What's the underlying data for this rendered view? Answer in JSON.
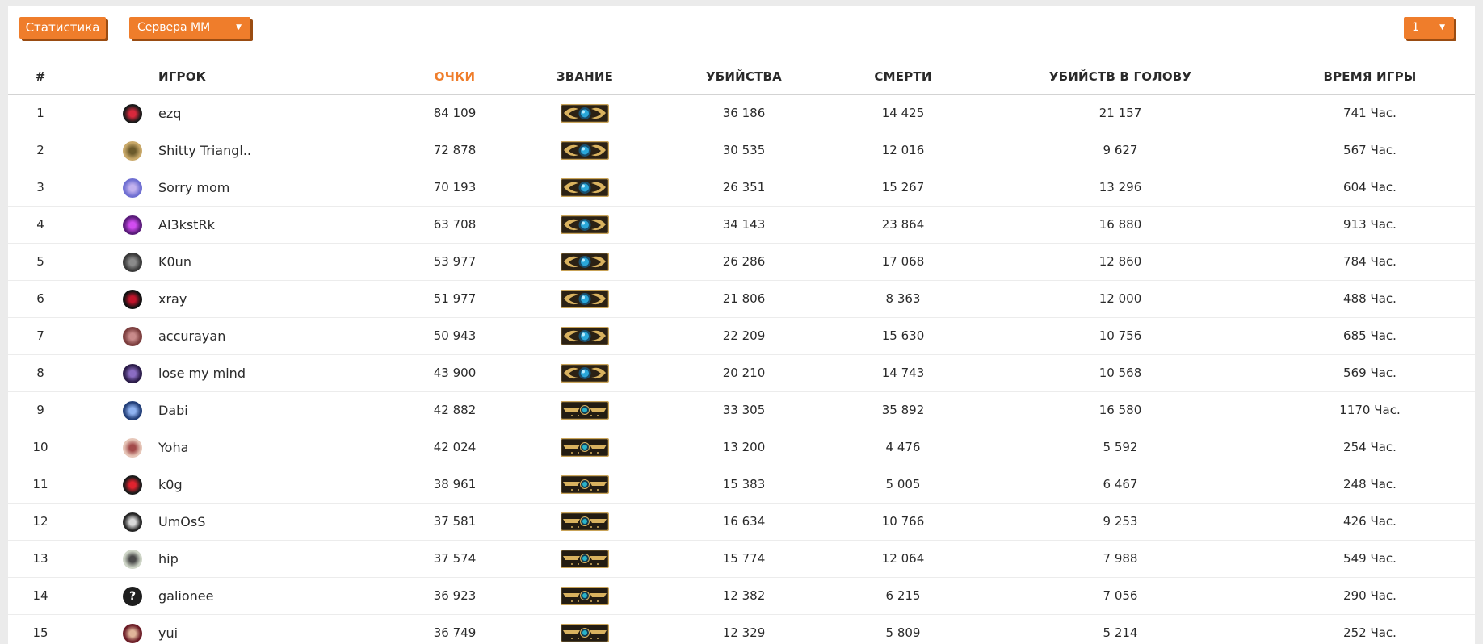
{
  "toolbar": {
    "stats_label": "Статистика",
    "servers_label": "Сервера ММ",
    "page_value": "1"
  },
  "columns": {
    "index": "#",
    "player": "ИГРОК",
    "points": "ОЧКИ",
    "rank": "ЗВАНИЕ",
    "kills": "УБИЙСТВА",
    "deaths": "СМЕРТИ",
    "headshots": "УБИЙСТВ В ГОЛОВУ",
    "playtime": "ВРЕМЯ ИГРЫ"
  },
  "colors": {
    "accent": "#ef7d2b",
    "accent_shadow": "#9a4c12",
    "text": "#2a2a2a"
  },
  "players": [
    {
      "n": "1",
      "name": "ezq",
      "points": "84 109",
      "rank": "global-elite",
      "kills": "36 186",
      "deaths": "14 425",
      "hs": "21 157",
      "time": "741 Час.",
      "avatar": {
        "color": "#1a1a1a",
        "accent": "#d8283c",
        "glyph": ""
      }
    },
    {
      "n": "2",
      "name": "Shitty Triangl..",
      "points": "72 878",
      "rank": "global-elite",
      "kills": "30 535",
      "deaths": "12 016",
      "hs": "9 627",
      "time": "567 Час.",
      "avatar": {
        "color": "#c9a96a",
        "accent": "#6b5a2c",
        "glyph": ""
      }
    },
    {
      "n": "3",
      "name": "Sorry mom",
      "points": "70 193",
      "rank": "global-elite",
      "kills": "26 351",
      "deaths": "15 267",
      "hs": "13 296",
      "time": "604 Час.",
      "avatar": {
        "color": "#6f6fd2",
        "accent": "#c2b1ee",
        "glyph": ""
      }
    },
    {
      "n": "4",
      "name": "Al3kstRk",
      "points": "63 708",
      "rank": "global-elite",
      "kills": "34 143",
      "deaths": "23 864",
      "hs": "16 880",
      "time": "913 Час.",
      "avatar": {
        "color": "#5a1c7a",
        "accent": "#d14cf0",
        "glyph": ""
      }
    },
    {
      "n": "5",
      "name": "K0un",
      "points": "53 977",
      "rank": "global-elite",
      "kills": "26 286",
      "deaths": "17 068",
      "hs": "12 860",
      "time": "784 Час.",
      "avatar": {
        "color": "#3a3a3a",
        "accent": "#8a8a8a",
        "glyph": ""
      }
    },
    {
      "n": "6",
      "name": "xray",
      "points": "51 977",
      "rank": "global-elite",
      "kills": "21 806",
      "deaths": "8 363",
      "hs": "12 000",
      "time": "488 Час.",
      "avatar": {
        "color": "#111111",
        "accent": "#c0142b",
        "glyph": ""
      }
    },
    {
      "n": "7",
      "name": "accurayan",
      "points": "50 943",
      "rank": "global-elite",
      "kills": "22 209",
      "deaths": "15 630",
      "hs": "10 756",
      "time": "685 Час.",
      "avatar": {
        "color": "#7c3e3e",
        "accent": "#c88a8a",
        "glyph": ""
      }
    },
    {
      "n": "8",
      "name": "lose my mind",
      "points": "43 900",
      "rank": "global-elite",
      "kills": "20 210",
      "deaths": "14 743",
      "hs": "10 568",
      "time": "569 Час.",
      "avatar": {
        "color": "#2c1d4a",
        "accent": "#8a6cc2",
        "glyph": ""
      }
    },
    {
      "n": "9",
      "name": "Dabi",
      "points": "42 882",
      "rank": "supreme",
      "kills": "33 305",
      "deaths": "35 892",
      "hs": "16 580",
      "time": "1170 Час.",
      "avatar": {
        "color": "#24407a",
        "accent": "#8fb2f0",
        "glyph": ""
      }
    },
    {
      "n": "10",
      "name": "Yoha",
      "points": "42 024",
      "rank": "supreme",
      "kills": "13 200",
      "deaths": "4 476",
      "hs": "5 592",
      "time": "254 Час.",
      "avatar": {
        "color": "#e6c6b8",
        "accent": "#a24a4a",
        "glyph": ""
      }
    },
    {
      "n": "11",
      "name": "k0g",
      "points": "38 961",
      "rank": "supreme",
      "kills": "15 383",
      "deaths": "5 005",
      "hs": "6 467",
      "time": "248 Час.",
      "avatar": {
        "color": "#1b1b1b",
        "accent": "#e0222e",
        "glyph": ""
      }
    },
    {
      "n": "12",
      "name": "UmOsS",
      "points": "37 581",
      "rank": "supreme",
      "kills": "16 634",
      "deaths": "10 766",
      "hs": "9 253",
      "time": "426 Час.",
      "avatar": {
        "color": "#262626",
        "accent": "#d8d8d8",
        "glyph": ""
      }
    },
    {
      "n": "13",
      "name": "hip",
      "points": "37 574",
      "rank": "supreme",
      "kills": "15 774",
      "deaths": "12 064",
      "hs": "7 988",
      "time": "549 Час.",
      "avatar": {
        "color": "#cfd6c8",
        "accent": "#4b4b4b",
        "glyph": ""
      }
    },
    {
      "n": "14",
      "name": "galionee",
      "points": "36 923",
      "rank": "supreme",
      "kills": "12 382",
      "deaths": "6 215",
      "hs": "7 056",
      "time": "290 Час.",
      "avatar": {
        "color": "#1e1e1e",
        "accent": "#ffffff",
        "glyph": "?"
      }
    },
    {
      "n": "15",
      "name": "yui",
      "points": "36 749",
      "rank": "supreme",
      "kills": "12 329",
      "deaths": "5 809",
      "hs": "5 214",
      "time": "252 Час.",
      "avatar": {
        "color": "#6b1c26",
        "accent": "#e0b59a",
        "glyph": ""
      }
    }
  ]
}
